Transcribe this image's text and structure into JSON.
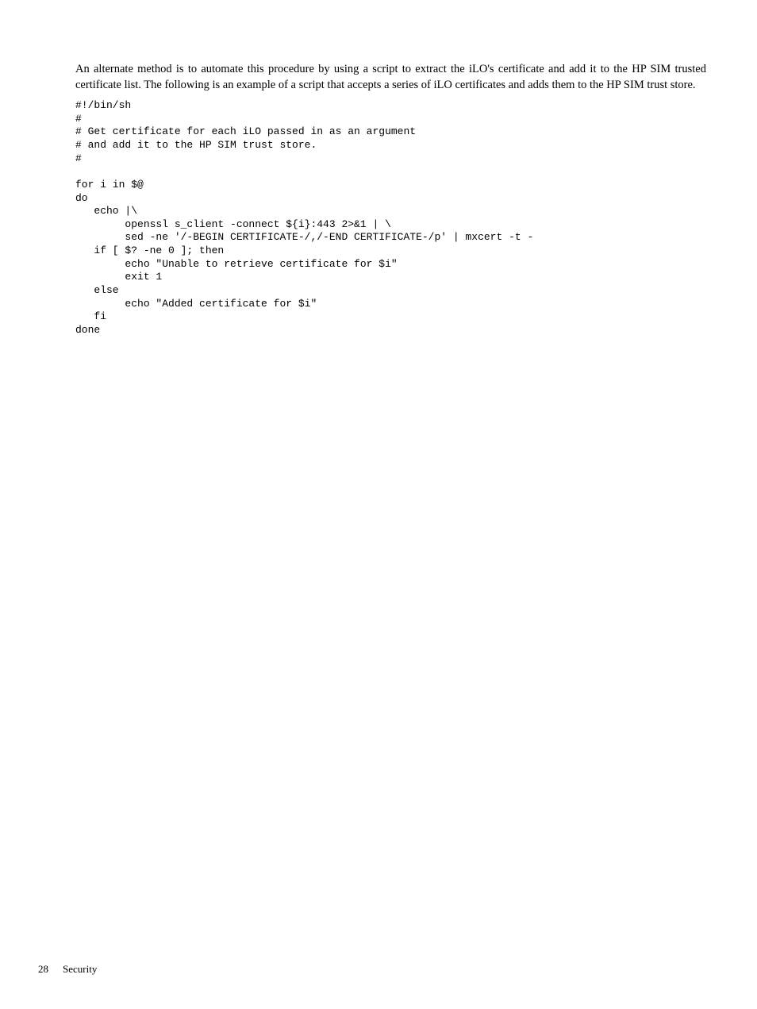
{
  "intro": "An alternate method is to automate this procedure by using a script to extract the iLO's certificate and add it to the HP SIM trusted certificate list. The following is an example of a script that accepts a series of iLO certificates and adds them to the HP SIM trust store.",
  "code": {
    "l01": "#!/bin/sh",
    "l02": "#",
    "l03": "# Get certificate for each iLO passed in as an argument",
    "l04": "# and add it to the HP SIM trust store.",
    "l05": "#",
    "l06": "",
    "l07": "for i in $@",
    "l08": "do",
    "l09": "   echo |\\",
    "l10": "        openssl s_client -connect ${i}:443 2>&1 | \\",
    "l11": "        sed -ne '/-BEGIN CERTIFICATE-/,/-END CERTIFICATE-/p' | mxcert -t -",
    "l12": "   if [ $? -ne 0 ]; then",
    "l13": "        echo \"Unable to retrieve certificate for $i\"",
    "l14": "        exit 1",
    "l15": "   else",
    "l16": "        echo \"Added certificate for $i\"",
    "l17": "   fi",
    "l18": "done"
  },
  "footer": {
    "page": "28",
    "section": "Security"
  }
}
